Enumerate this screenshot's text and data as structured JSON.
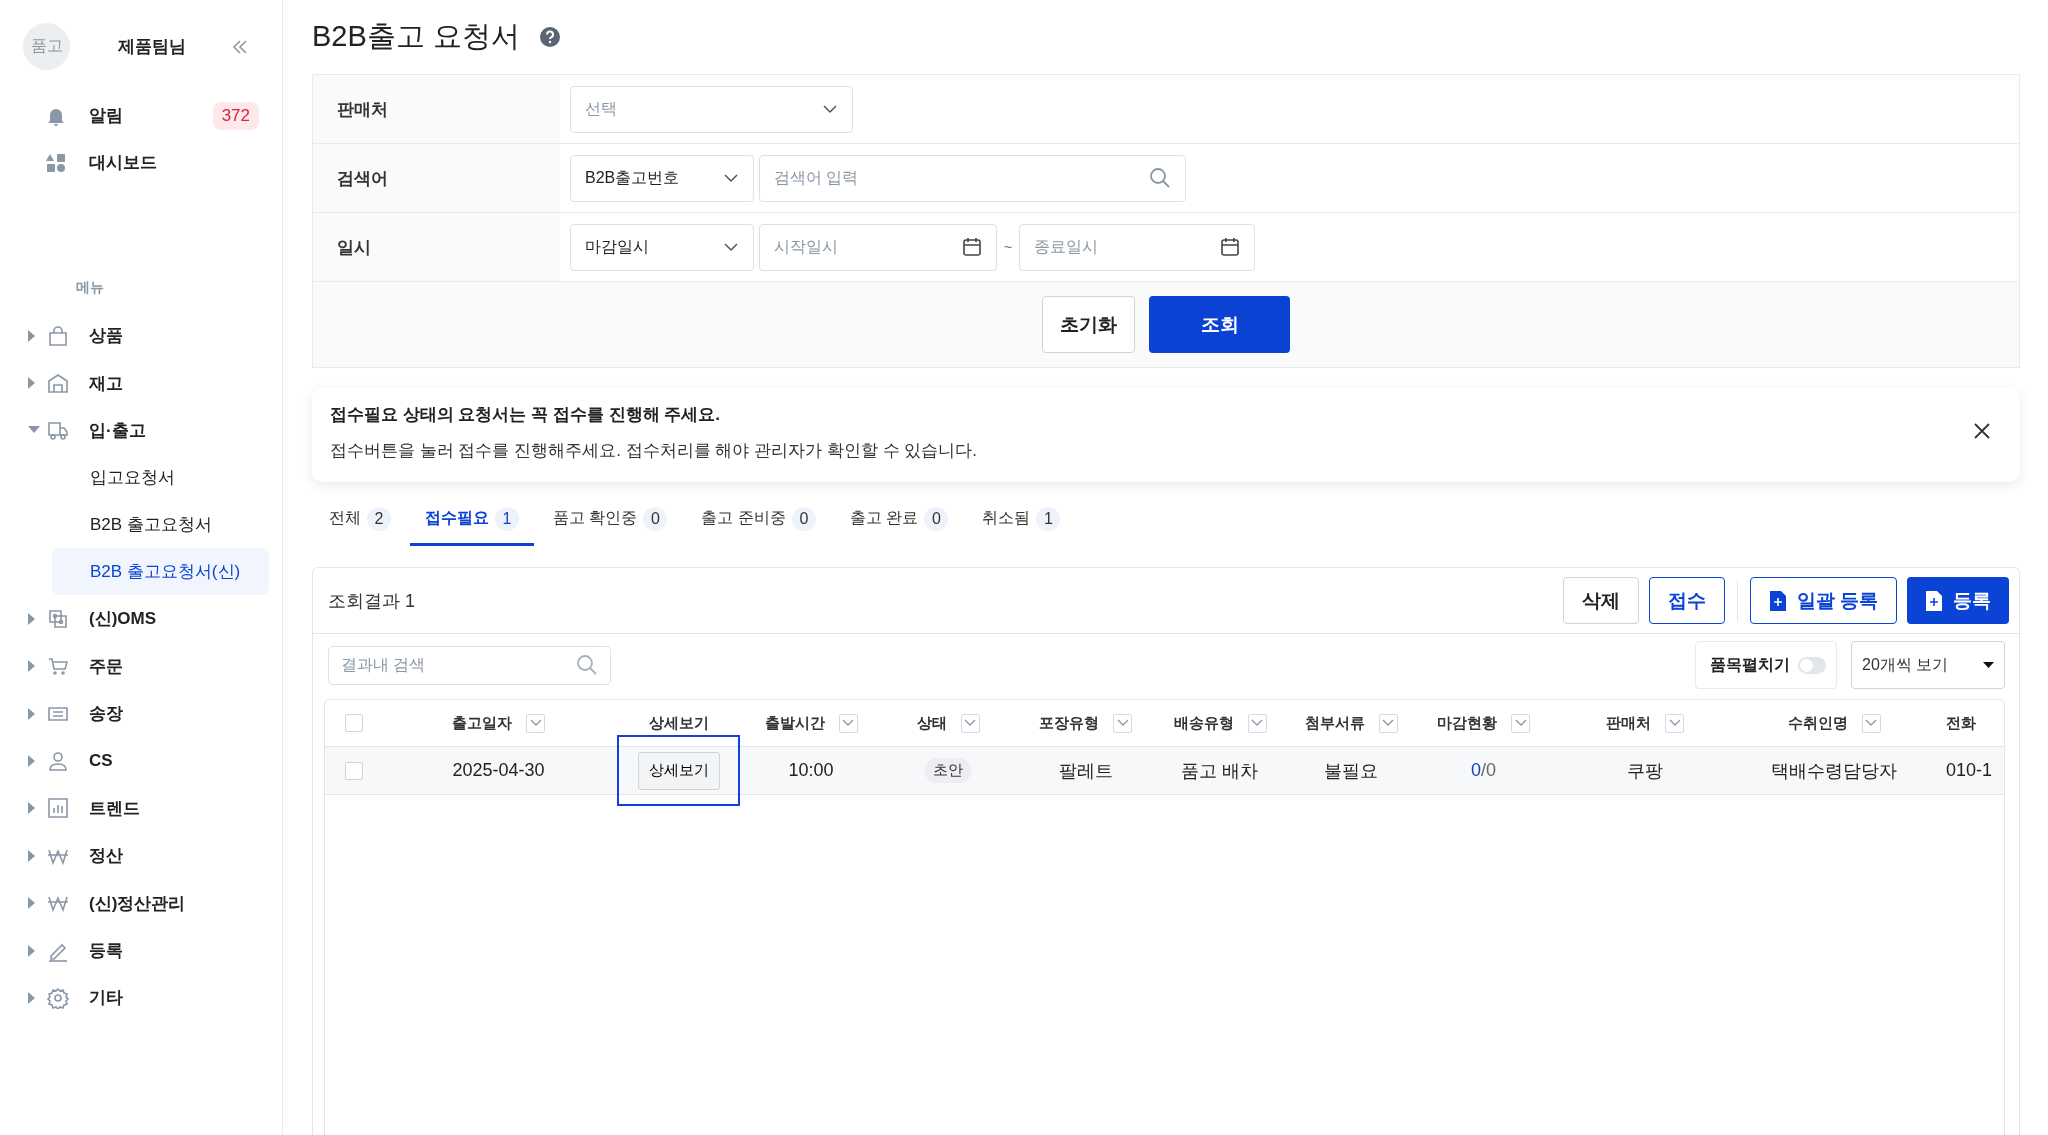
{
  "sidebar": {
    "avatar": "품고",
    "user": "제품팀님",
    "quick_links": [
      {
        "label": "알림",
        "badge": "372"
      },
      {
        "label": "대시보드"
      }
    ],
    "menu_title": "메뉴",
    "menu": [
      {
        "label": "상품",
        "expanded": false,
        "selected": false
      },
      {
        "label": "재고",
        "expanded": false,
        "selected": false
      },
      {
        "label": "입·출고",
        "expanded": true,
        "selected": false,
        "children": [
          {
            "label": "입고요청서",
            "selected": false
          },
          {
            "label": "B2B 출고요청서",
            "selected": false
          },
          {
            "label": "B2B 출고요청서(신)",
            "selected": true
          }
        ]
      },
      {
        "label": "(신)OMS",
        "expanded": false,
        "selected": false
      },
      {
        "label": "주문",
        "expanded": false,
        "selected": false
      },
      {
        "label": "송장",
        "expanded": false,
        "selected": false
      },
      {
        "label": "CS",
        "expanded": false,
        "selected": false
      },
      {
        "label": "트렌드",
        "expanded": false,
        "selected": false
      },
      {
        "label": "정산",
        "expanded": false,
        "selected": false
      },
      {
        "label": "(신)정산관리",
        "expanded": false,
        "selected": false
      },
      {
        "label": "등록",
        "expanded": false,
        "selected": false
      },
      {
        "label": "기타",
        "expanded": false,
        "selected": false
      }
    ]
  },
  "page": {
    "title": "B2B출고 요청서"
  },
  "filters": {
    "rows": [
      {
        "kind": "select",
        "label": "판매처",
        "select": {
          "placeholder": "선택"
        }
      },
      {
        "kind": "search",
        "label": "검색어",
        "select": {
          "value": "B2B출고번호"
        },
        "input": {
          "placeholder": "검색어 입력"
        }
      },
      {
        "kind": "date-range",
        "label": "일시",
        "select": {
          "value": "마감일시"
        },
        "start": {
          "placeholder": "시작일시"
        },
        "separator": "~",
        "end": {
          "placeholder": "종료일시"
        }
      }
    ],
    "buttons": [
      {
        "label": "초기화",
        "kind": "secondary"
      },
      {
        "label": "조회",
        "kind": "primary"
      }
    ]
  },
  "notice": {
    "title": "접수필요 상태의 요청서는 꼭 접수를 진행해 주세요.",
    "message": "접수버튼을 눌러 접수를 진행해주세요. 접수처리를 해야 관리자가 확인할 수 있습니다."
  },
  "tabs": [
    {
      "label": "전체",
      "count": "2",
      "selected": false
    },
    {
      "label": "접수필요",
      "count": "1",
      "selected": true
    },
    {
      "label": "품고 확인중",
      "count": "0",
      "selected": false
    },
    {
      "label": "출고 준비중",
      "count": "0",
      "selected": false
    },
    {
      "label": "출고 완료",
      "count": "0",
      "selected": false
    },
    {
      "label": "취소됨",
      "count": "1",
      "selected": false
    }
  ],
  "results": {
    "title": "조회결과 1",
    "actions": [
      {
        "label": "삭제",
        "kind": "default"
      },
      {
        "label": "접수",
        "kind": "outline"
      },
      {
        "label": "일괄 등록",
        "kind": "outline-icon"
      },
      {
        "label": "등록",
        "kind": "primary-icon"
      }
    ],
    "search": {
      "placeholder": "결과내 검색"
    },
    "expand_toggle": {
      "label": "품목펼치기",
      "on": false
    },
    "page_size": {
      "value": "20개씩 보기"
    },
    "table": {
      "select_all_checked": false,
      "columns": [
        {
          "label": "출고일자",
          "kind": "filterable"
        },
        {
          "label": "상세보기",
          "kind": "plain"
        },
        {
          "label": "출발시간",
          "kind": "filterable"
        },
        {
          "label": "상태",
          "kind": "filterable"
        },
        {
          "label": "포장유형",
          "kind": "filterable"
        },
        {
          "label": "배송유형",
          "kind": "filterable"
        },
        {
          "label": "첨부서류",
          "kind": "filterable"
        },
        {
          "label": "마감현황",
          "kind": "filterable"
        },
        {
          "label": "판매처",
          "kind": "filterable"
        },
        {
          "label": "수취인명",
          "kind": "filterable"
        },
        {
          "label": "전화",
          "kind": "plain"
        }
      ],
      "rows": [
        {
          "checked": false,
          "cells": [
            {
              "kind": "text",
              "text": "2025-04-30"
            },
            {
              "kind": "button",
              "text": "상세보기",
              "highlighted": true
            },
            {
              "kind": "text",
              "text": "10:00"
            },
            {
              "kind": "badge",
              "text": "초안"
            },
            {
              "kind": "text",
              "text": "팔레트"
            },
            {
              "kind": "text",
              "text": "품고 배차"
            },
            {
              "kind": "text",
              "text": "불필요"
            },
            {
              "kind": "ratio",
              "done": "0",
              "rest": "/0"
            },
            {
              "kind": "text",
              "text": "쿠팡"
            },
            {
              "kind": "text",
              "text": "택배수령담당자"
            },
            {
              "kind": "text",
              "text": "010-1"
            }
          ]
        }
      ]
    }
  }
}
